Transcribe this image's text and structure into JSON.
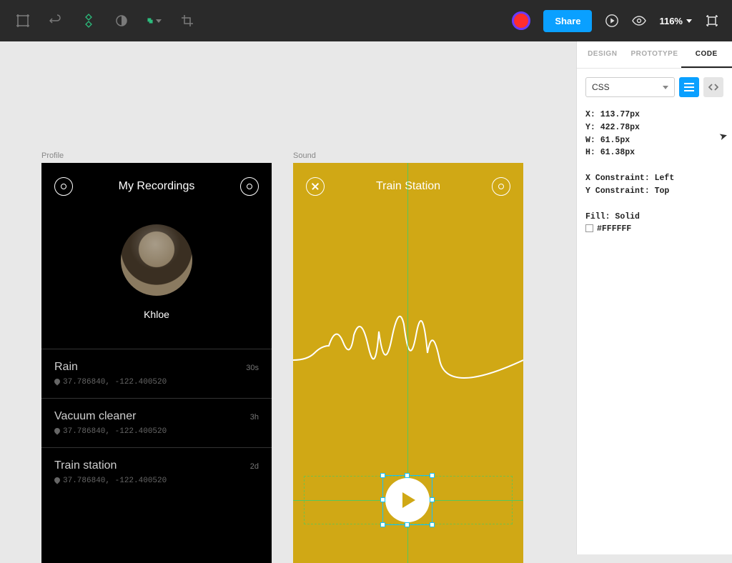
{
  "toolbar": {
    "share_label": "Share",
    "zoom": "116%"
  },
  "artboards": {
    "profile_label": "Profile",
    "profile": {
      "title": "My Recordings",
      "username": "Khloe",
      "items": [
        {
          "name": "Rain",
          "duration": "30s",
          "coords": "37.786840, -122.400520"
        },
        {
          "name": "Vacuum cleaner",
          "duration": "3h",
          "coords": "37.786840, -122.400520"
        },
        {
          "name": "Train station",
          "duration": "2d",
          "coords": "37.786840, -122.400520"
        }
      ]
    },
    "sound_label": "Sound",
    "sound_title": "Train Station"
  },
  "inspector": {
    "tabs": {
      "design": "DESIGN",
      "prototype": "PROTOTYPE",
      "code": "CODE"
    },
    "language": "CSS",
    "props": {
      "x_label": "X:",
      "x_value": "113.77px",
      "y_label": "Y:",
      "y_value": "422.78px",
      "w_label": "W:",
      "w_value": "61.5px",
      "h_label": "H:",
      "h_value": "61.38px",
      "xc_label": "X Constraint:",
      "xc_value": "Left",
      "yc_label": "Y Constraint:",
      "yc_value": "Top",
      "fill_label": "Fill:",
      "fill_value": "Solid",
      "fill_color": "#FFFFFF"
    }
  }
}
